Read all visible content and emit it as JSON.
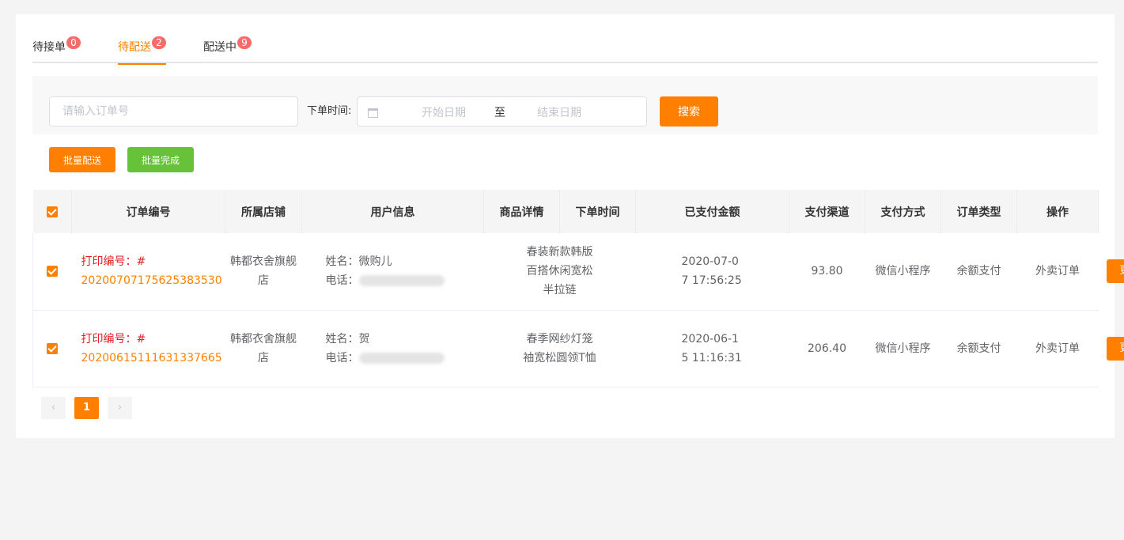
{
  "tabs": [
    {
      "label": "待接单",
      "count": "0"
    },
    {
      "label": "待配送",
      "count": "2"
    },
    {
      "label": "配送中",
      "count": "9"
    }
  ],
  "filter": {
    "order_placeholder": "请输入订单号",
    "time_label": "下单时间:",
    "start_placeholder": "开始日期",
    "separator": "至",
    "end_placeholder": "结束日期",
    "search_label": "搜索"
  },
  "bulk": {
    "ship_label": "批量配送",
    "done_label": "批量完成"
  },
  "table": {
    "columns": [
      "订单编号",
      "所属店铺",
      "用户信息",
      "商品详情",
      "下单时间",
      "已支付金额",
      "支付渠道",
      "支付方式",
      "订单类型",
      "操作"
    ],
    "rows": [
      {
        "print_no": "打印编号：#",
        "order_no": "20200707175625383530",
        "store": "韩都衣舍旗舰店",
        "name": "姓名：微购儿",
        "phone_label": "电话：",
        "goods": "春装新款韩版百搭休闲宽松半拉链",
        "time": "2020-07-07 17:56:25",
        "amount": "93.80",
        "channel": "微信小程序",
        "method": "余额支付",
        "type": "外卖订单",
        "action": "更多 ⌵"
      },
      {
        "print_no": "打印编号：#",
        "order_no": "20200615111631337665",
        "store": "韩都衣舍旗舰店",
        "name": "姓名：贺",
        "phone_label": "电话：",
        "goods": "春季网纱灯笼袖宽松圆领T恤",
        "time": "2020-06-15 11:16:31",
        "amount": "206.40",
        "channel": "微信小程序",
        "method": "余额支付",
        "type": "外卖订单",
        "action": "更多 ⌵"
      }
    ]
  },
  "pagination": {
    "prev": "‹",
    "current": "1",
    "next": "›"
  },
  "colors": {
    "accent": "#ff8000",
    "success": "#67c23a",
    "badge": "#f56c6c",
    "amount": "#1e7e1e"
  }
}
